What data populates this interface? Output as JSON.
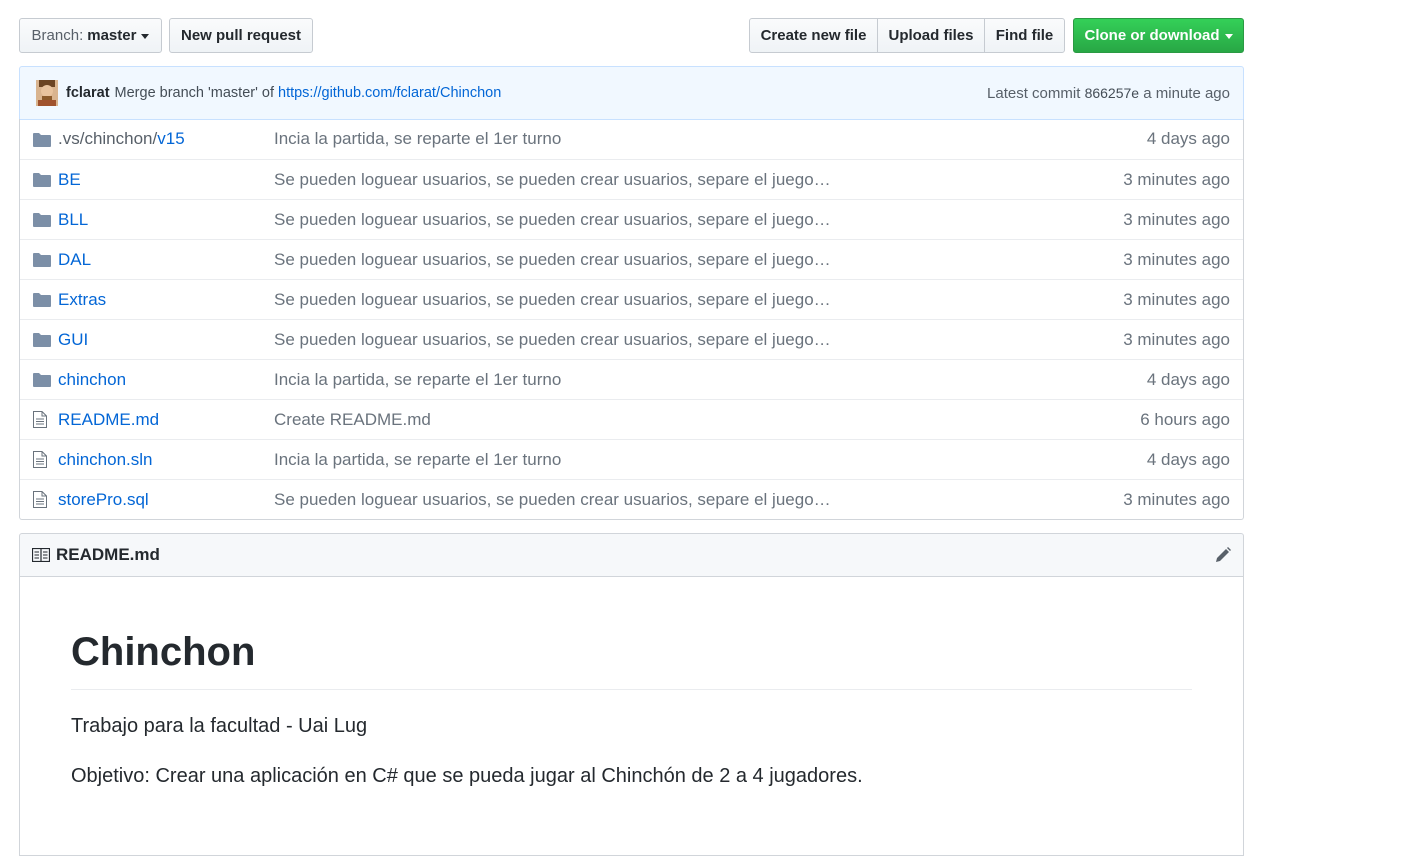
{
  "toolbar": {
    "branch_prefix": "Branch:",
    "branch_name": "master",
    "new_pr": "New pull request",
    "create_file": "Create new file",
    "upload": "Upload files",
    "find": "Find file",
    "clone": "Clone or download"
  },
  "commit": {
    "author": "fclarat",
    "message": "Merge branch 'master' of",
    "link": "https://github.com/fclarat/Chinchon",
    "latest_prefix": "Latest commit",
    "sha": "866257e",
    "age": "a minute ago"
  },
  "files": [
    {
      "type": "dir",
      "prefix": ".vs/chinchon/",
      "name": "v15",
      "message": "Incia la partida, se reparte el 1er turno",
      "age": "4 days ago"
    },
    {
      "type": "dir",
      "prefix": "",
      "name": "BE",
      "message": "Se pueden loguear usuarios, se pueden crear usuarios, separe el juego…",
      "age": "3 minutes ago"
    },
    {
      "type": "dir",
      "prefix": "",
      "name": "BLL",
      "message": "Se pueden loguear usuarios, se pueden crear usuarios, separe el juego…",
      "age": "3 minutes ago"
    },
    {
      "type": "dir",
      "prefix": "",
      "name": "DAL",
      "message": "Se pueden loguear usuarios, se pueden crear usuarios, separe el juego…",
      "age": "3 minutes ago"
    },
    {
      "type": "dir",
      "prefix": "",
      "name": "Extras",
      "message": "Se pueden loguear usuarios, se pueden crear usuarios, separe el juego…",
      "age": "3 minutes ago"
    },
    {
      "type": "dir",
      "prefix": "",
      "name": "GUI",
      "message": "Se pueden loguear usuarios, se pueden crear usuarios, separe el juego…",
      "age": "3 minutes ago"
    },
    {
      "type": "dir",
      "prefix": "",
      "name": "chinchon",
      "message": "Incia la partida, se reparte el 1er turno",
      "age": "4 days ago"
    },
    {
      "type": "file",
      "prefix": "",
      "name": "README.md",
      "message": "Create README.md",
      "age": "6 hours ago"
    },
    {
      "type": "file",
      "prefix": "",
      "name": "chinchon.sln",
      "message": "Incia la partida, se reparte el 1er turno",
      "age": "4 days ago"
    },
    {
      "type": "file",
      "prefix": "",
      "name": "storePro.sql",
      "message": "Se pueden loguear usuarios, se pueden crear usuarios, separe el juego…",
      "age": "3 minutes ago"
    }
  ],
  "readme": {
    "filename": "README.md",
    "title": "Chinchon",
    "p1": "Trabajo para la facultad - Uai Lug",
    "p2": "Objetivo: Crear una aplicación en C# que se pueda jugar al Chinchón de 2 a 4 jugadores."
  },
  "colors": {
    "link": "#0366d6",
    "primary": "#28a745",
    "commit_bg": "#f1f8ff"
  }
}
